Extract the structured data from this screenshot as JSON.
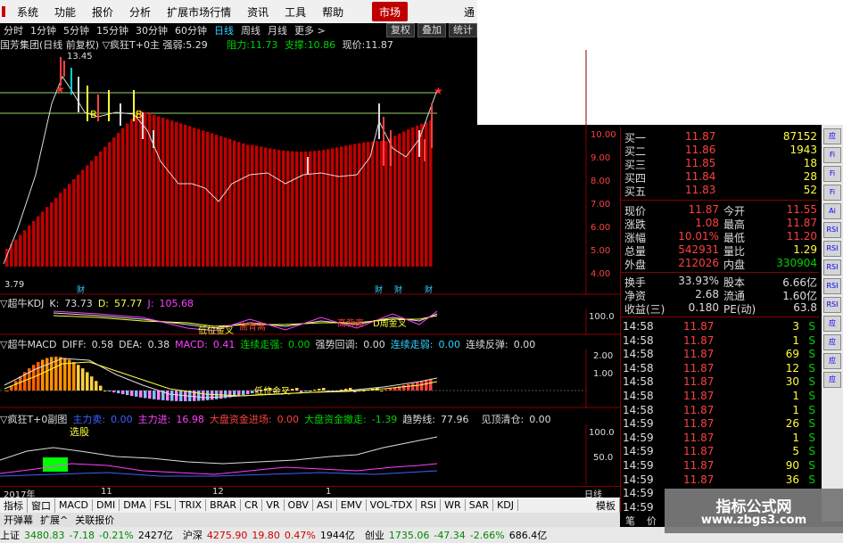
{
  "menu": {
    "items": [
      "系统",
      "功能",
      "报价",
      "分析",
      "扩展市场行情",
      "资讯",
      "工具",
      "帮助"
    ],
    "market_tab": "市场",
    "right_text": "通"
  },
  "periods": {
    "items": [
      "分时",
      "1分钟",
      "5分钟",
      "15分钟",
      "30分钟",
      "60分钟",
      "日线",
      "周线",
      "月线",
      "更多 >"
    ],
    "active": "日线",
    "buttons": [
      "复权",
      "叠加",
      "统计"
    ]
  },
  "main_chart": {
    "name": "国芳集团(日线 前复权)",
    "indicator": "▽疯狂T+0主",
    "strength_label": "强弱:",
    "strength_value": "5.29",
    "resist_label": "阻力:",
    "resist_value": "11.73",
    "support_label": "支撑:",
    "support_value": "10.86",
    "price_label": "现价:",
    "price_value": "11.87",
    "high_mark": "13.45",
    "low_mark": "3.79",
    "markers": [
      "B",
      "B"
    ],
    "cai_labels": [
      "财",
      "财",
      "财",
      "财"
    ],
    "y_ticks": [
      "10.00",
      "9.00",
      "8.00",
      "7.00",
      "6.00",
      "5.00",
      "4.00"
    ]
  },
  "kdj": {
    "title": "▽超牛KDJ",
    "k_label": "K:",
    "k_value": "73.73",
    "d_label": "D:",
    "d_value": "57.77",
    "j_label": "J:",
    "j_value": "105.68",
    "labels": [
      "低位金叉",
      "高背离",
      "高背离",
      "D周金叉"
    ],
    "y_tick": "100.0"
  },
  "macd": {
    "title": "▽超牛MACD",
    "diff_label": "DIFF:",
    "diff_value": "0.58",
    "dea_label": "DEA:",
    "dea_value": "0.38",
    "macd_label": "MACD:",
    "macd_value": "0.41",
    "lianxu_label": "连续走强:",
    "lianxu_value": "0.00",
    "qiangshi_label": "强势回调:",
    "qiangshi_value": "0.00",
    "lianxu2_label": "连续走弱:",
    "lianxu2_value": "0.00",
    "fantan_label": "连续反弹:",
    "fantan_value": "0.00",
    "labels": [
      "低位金叉"
    ],
    "y_ticks": [
      "2.00",
      "1.00"
    ]
  },
  "fund": {
    "title": "▽疯狂T+0副图",
    "zhuli_out_label": "主力卖:",
    "zhuli_out_value": "0.00",
    "zhuli_in_label": "主力进:",
    "zhuli_in_value": "16.98",
    "dapan_in_label": "大盘资金进场:",
    "dapan_in_value": "0.00",
    "dapan_out_label": "大盘资金撤走:",
    "dapan_out_value": "-1.39",
    "trend_label": "趋势线:",
    "trend_value": "77.96",
    "warn_label": "见顶清仓:",
    "warn_value": "0.00",
    "tag": "选股",
    "y_ticks": [
      "100.0",
      "50.0"
    ]
  },
  "axis": {
    "year": "2017年",
    "months": [
      "11",
      "12",
      "1"
    ],
    "period": "日线"
  },
  "quote": {
    "bids": [
      {
        "label": "买一",
        "price": "11.87",
        "vol": "87152"
      },
      {
        "label": "买二",
        "price": "11.86",
        "vol": "1943"
      },
      {
        "label": "买三",
        "price": "11.85",
        "vol": "18"
      },
      {
        "label": "买四",
        "price": "11.84",
        "vol": "28"
      },
      {
        "label": "买五",
        "price": "11.83",
        "vol": "52"
      }
    ],
    "stats": [
      {
        "l1": "现价",
        "v1": "11.87",
        "l2": "今开",
        "v2": "11.55"
      },
      {
        "l1": "涨跌",
        "v1": "1.08",
        "l2": "最高",
        "v2": "11.87"
      },
      {
        "l1": "涨幅",
        "v1": "10.01%",
        "l2": "最低",
        "v2": "11.20"
      },
      {
        "l1": "总量",
        "v1": "542931",
        "l2": "量比",
        "v2": "1.29"
      },
      {
        "l1": "外盘",
        "v1": "212026",
        "l2": "内盘",
        "v2": "330904"
      }
    ],
    "stats2": [
      {
        "l1": "换手",
        "v1": "33.93%",
        "l2": "股本",
        "v2": "6.66亿"
      },
      {
        "l1": "净资",
        "v1": "2.68",
        "l2": "流通",
        "v2": "1.60亿"
      },
      {
        "l1": "收益(三)",
        "v1": "0.180",
        "l2": "PE(动)",
        "v2": "63.8"
      }
    ],
    "ticks": [
      {
        "t": "14:58",
        "p": "11.87",
        "v": "3",
        "s": "S"
      },
      {
        "t": "14:58",
        "p": "11.87",
        "v": "1",
        "s": "S"
      },
      {
        "t": "14:58",
        "p": "11.87",
        "v": "69",
        "s": "S"
      },
      {
        "t": "14:58",
        "p": "11.87",
        "v": "12",
        "s": "S"
      },
      {
        "t": "14:58",
        "p": "11.87",
        "v": "30",
        "s": "S"
      },
      {
        "t": "14:58",
        "p": "11.87",
        "v": "1",
        "s": "S"
      },
      {
        "t": "14:58",
        "p": "11.87",
        "v": "1",
        "s": "S"
      },
      {
        "t": "14:59",
        "p": "11.87",
        "v": "26",
        "s": "S"
      },
      {
        "t": "14:59",
        "p": "11.87",
        "v": "1",
        "s": "S"
      },
      {
        "t": "14:59",
        "p": "11.87",
        "v": "5",
        "s": "S"
      },
      {
        "t": "14:59",
        "p": "11.87",
        "v": "90",
        "s": "S"
      },
      {
        "t": "14:59",
        "p": "11.87",
        "v": "36",
        "s": "S"
      },
      {
        "t": "14:59",
        "p": "",
        "v": "",
        "s": ""
      },
      {
        "t": "14:59",
        "p": "",
        "v": "",
        "s": ""
      }
    ],
    "bottom_tabs": [
      "笔",
      "价"
    ]
  },
  "sidebar": [
    "应",
    "Fi",
    "Fi",
    "Fi",
    "Ai",
    "RSI",
    "RSI",
    "RSI",
    "RSI",
    "RSI",
    "应",
    "应",
    "应",
    "应"
  ],
  "tabs": [
    "指标",
    "窗口",
    "MACD",
    "DMI",
    "DMA",
    "FSL",
    "TRIX",
    "BRAR",
    "CR",
    "VR",
    "OBV",
    "ASI",
    "EMV",
    "VOL-TDX",
    "RSI",
    "WR",
    "SAR",
    "KDJ"
  ],
  "tabs_right": "模板",
  "tabs2": [
    "开弹幕",
    "扩展^",
    "关联报价"
  ],
  "status": [
    {
      "label": "上证",
      "value": "3480.83",
      "chg": "-7.18",
      "pct": "-0.21%",
      "amt": "2427亿"
    },
    {
      "label": "沪深",
      "value": "4275.90",
      "chg": "19.80",
      "pct": "0.47%",
      "amt": "1944亿"
    },
    {
      "label": "创业",
      "value": "1735.06",
      "chg": "-47.34",
      "pct": "-2.66%",
      "amt": "686.4亿"
    }
  ],
  "watermark": {
    "line1": "指标公式网",
    "line2": "www.zbgs3.com"
  }
}
